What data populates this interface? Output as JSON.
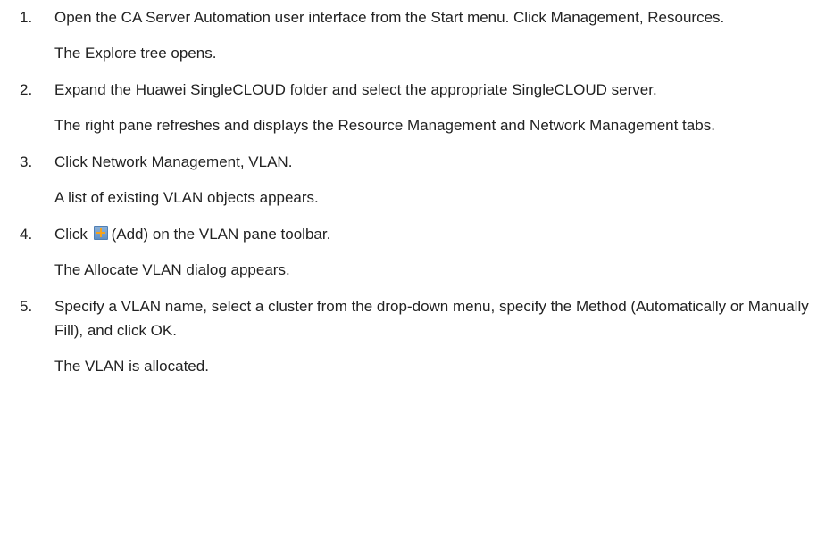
{
  "steps": [
    {
      "number": "1.",
      "text": "Open the CA Server Automation user interface from the Start menu. Click Management, Resources.",
      "result": "The Explore tree opens."
    },
    {
      "number": "2.",
      "text": "Expand the Huawei SingleCLOUD folder and select the appropriate SingleCLOUD server.",
      "result": "The right pane refreshes and displays the Resource Management and Network Management tabs."
    },
    {
      "number": "3.",
      "text": "Click Network Management, VLAN.",
      "result": "A list of existing VLAN objects appears."
    },
    {
      "number": "4.",
      "text_before_icon": "Click",
      "icon": "add-icon",
      "text_after_icon": "(Add) on the VLAN pane toolbar.",
      "result": "The Allocate VLAN dialog appears."
    },
    {
      "number": "5.",
      "text": "Specify a VLAN name, select a cluster from the drop-down menu, specify the Method (Automatically or Manually Fill), and click OK.",
      "result": "The VLAN is allocated."
    }
  ],
  "colors": {
    "text": "#222222",
    "icon_blue": "#6e9ccc",
    "icon_plus": "#f6a21a"
  }
}
